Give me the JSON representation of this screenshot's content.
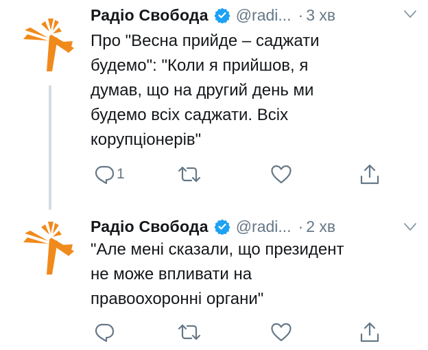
{
  "colors": {
    "brand_orange": "#f08a1c",
    "verified_blue": "#1da1f2",
    "muted_gray": "#657786",
    "text_dark": "#14171a",
    "thread_line": "#d3dbe2"
  },
  "tweets": [
    {
      "author_name": "Радіо Свобода",
      "handle": "@radi...",
      "separator": "·",
      "time": "3 хв",
      "text": "Про \"Весна прийде – саджати\nбудемо\": \"Коли я прийшов, я\nдумав, що на другий день ми\nбудемо всіх саджати. Всіх\nкорупціонерів\"",
      "reply_count": "1",
      "icons": [
        "verified-badge-icon",
        "chevron-down-icon",
        "reply-icon",
        "retweet-icon",
        "heart-icon",
        "share-icon"
      ]
    },
    {
      "author_name": "Радіо Свобода",
      "handle": "@radi...",
      "separator": "·",
      "time": "2 хв",
      "text": "\"Але мені сказали, що президент\nне може впливати на\nправоохоронні органи\"",
      "reply_count": "",
      "icons": [
        "verified-badge-icon",
        "chevron-down-icon",
        "reply-icon",
        "retweet-icon",
        "heart-icon",
        "share-icon"
      ]
    }
  ]
}
